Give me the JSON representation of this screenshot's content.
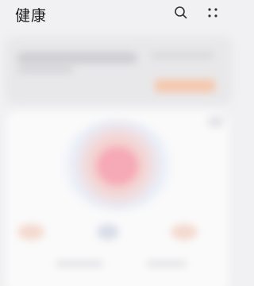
{
  "header": {
    "title": "健康",
    "search_icon": "search-icon",
    "more_icon": "more-dots-icon"
  },
  "colors": {
    "background": "#f1f1f3",
    "accent_orange": "#f6b48f",
    "accent_pink": "#f6a9b6"
  }
}
